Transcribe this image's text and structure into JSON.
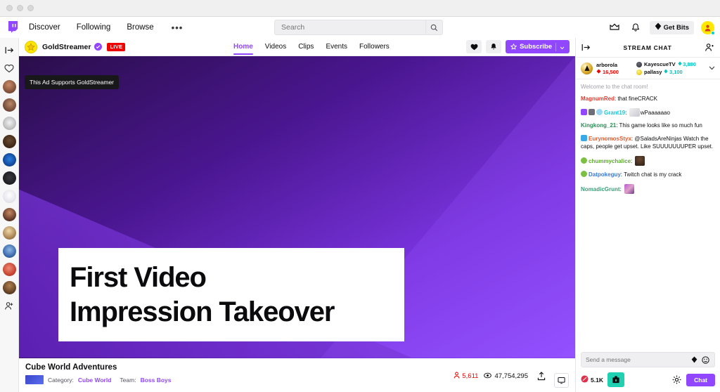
{
  "window": {
    "traffic_lights": [
      "close",
      "minimize",
      "maximize"
    ]
  },
  "topnav": {
    "logo_icon": "twitch-glitch-logo",
    "links": [
      {
        "label": "Discover"
      },
      {
        "label": "Following"
      },
      {
        "label": "Browse"
      }
    ],
    "more_label": "•••",
    "search": {
      "placeholder": "Search",
      "value": "",
      "icon": "search-icon"
    },
    "right": {
      "prime_icon": "prime-crown-icon",
      "notifications_icon": "bell-icon",
      "bits_label": "Get Bits",
      "bits_icon": "bits-diamond-icon",
      "avatar_icon": "user-avatar-icon"
    }
  },
  "left_sidebar": {
    "collapse_icon": "collapse-panel-icon",
    "heart_icon": "heart-outline-icon",
    "followed_count": 12,
    "friends_icon": "add-friend-icon"
  },
  "channel": {
    "avatar_icon": "gold-star-avatar",
    "name": "GoldStreamer",
    "verified_icon": "verified-check-icon",
    "live_badge": "LIVE",
    "tabs": [
      {
        "label": "Home",
        "active": true
      },
      {
        "label": "Videos",
        "active": false
      },
      {
        "label": "Clips",
        "active": false
      },
      {
        "label": "Events",
        "active": false
      },
      {
        "label": "Followers",
        "active": false
      }
    ],
    "actions": {
      "follow_icon": "heart-icon",
      "notify_icon": "bell-icon",
      "subscribe_label": "Subscribe",
      "subscribe_star_icon": "star-icon",
      "subscribe_caret_icon": "chevron-down-icon"
    }
  },
  "player": {
    "tooltip": "This Ad Supports GoldStreamer",
    "ad": {
      "line1": "First Video",
      "line2": "Impression Takeover"
    },
    "colors": {
      "purple_dark": "#2b0f4d",
      "purple_mid": "#6026c4",
      "purple_light": "#8a45f5",
      "card_bg": "#ffffff"
    }
  },
  "stream_info": {
    "title": "Cube World Adventures",
    "category_label": "Category:",
    "category_value": "Cube World",
    "team_label": "Team:",
    "team_value": "Boss Boys",
    "viewers": "5,611",
    "viewers_icon": "person-icon",
    "views": "47,754,295",
    "views_icon": "eye-icon",
    "share_icon": "share-upload-icon",
    "theatre_icon": "popout-chat-icon"
  },
  "chat": {
    "collapse_icon": "collapse-chat-icon",
    "title": "STREAM CHAT",
    "community_icon": "community-users-icon",
    "leaderboard": {
      "expand_icon": "chevron-down-icon",
      "leader": {
        "name": "arborola",
        "score": "16,500",
        "icon": "bits-red-icon"
      },
      "others": [
        {
          "name": "KayescueTV",
          "score": "3,880",
          "icon": "bits-cyan-icon",
          "color": "#3c3c46"
        },
        {
          "name": "pallasy",
          "score": "3,100",
          "icon": "bits-cyan-icon",
          "color": "#ffd400"
        }
      ]
    },
    "system_message": "Welcome to the chat room!",
    "messages": [
      {
        "user": "MagnumRed",
        "color": "#e03a2f",
        "badges": [],
        "text": "that fineCRACK",
        "emote": null
      },
      {
        "user": "Grant19",
        "color": "#1bc4d6",
        "badges": [
          "#9147ff",
          "#6e6e78",
          "#9ad8f0"
        ],
        "text": "wPaaaaaao",
        "emote": "cat-emote"
      },
      {
        "user": "Kingkong_21",
        "color": "#2e8b57",
        "badges": [],
        "text": "This game looks like so much fun",
        "emote": null
      },
      {
        "user": "EurynomosStyx",
        "color": "#e05a2f",
        "badges": [
          "#3aa9e8"
        ],
        "text": "@SaladsAreNinjas Watch the caps, people get upset. Like SUUUUUUUPER upset.",
        "emote": null
      },
      {
        "user": "chummychalice",
        "color": "#5fa832",
        "badges": [
          "#7bc043"
        ],
        "text": "",
        "emote": "face-emote"
      },
      {
        "user": "Datpokeguy",
        "color": "#3a78d8",
        "badges": [
          "#7bc043"
        ],
        "text": "Twitch chat is my crack",
        "emote": null
      },
      {
        "user": "NomadicGrunt",
        "color": "#3f9e7a",
        "badges": [],
        "text": "",
        "emote": "pixel-emote"
      }
    ],
    "input": {
      "placeholder": "Send a message",
      "value": "",
      "bits_icon": "bits-diamond-icon",
      "emote_icon": "smiley-emote-icon"
    },
    "footer": {
      "bits_count": "5.1K",
      "bits_icon": "bits-red-icon",
      "extension_icon": "extension-box-icon",
      "settings_icon": "gear-icon",
      "send_label": "Chat"
    }
  }
}
